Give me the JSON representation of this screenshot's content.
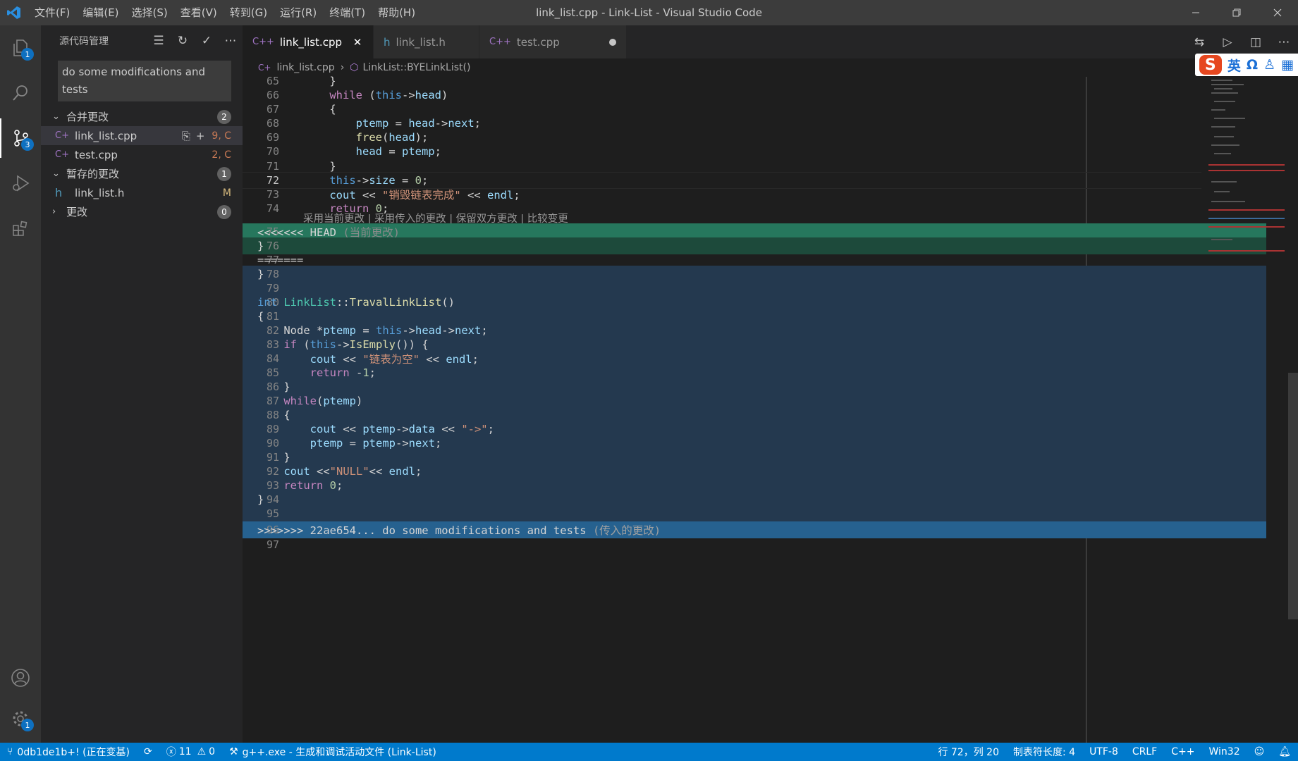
{
  "window": {
    "title": "link_list.cpp - Link-List - Visual Studio Code",
    "menu": [
      "文件(F)",
      "编辑(E)",
      "选择(S)",
      "查看(V)",
      "转到(G)",
      "运行(R)",
      "终端(T)",
      "帮助(H)"
    ]
  },
  "activity": {
    "explorer_badge": "1",
    "scm_badge": "3",
    "settings_badge": "1"
  },
  "sidebar": {
    "title": "源代码管理",
    "commit_message": "do some modifications and tests",
    "merge_section": {
      "label": "合并更改",
      "count": "2"
    },
    "merge_files": [
      {
        "name": "link_list.cpp",
        "status": "9, C"
      },
      {
        "name": "test.cpp",
        "status": "2, C"
      }
    ],
    "staged_section": {
      "label": "暂存的更改",
      "count": "1"
    },
    "staged_files": [
      {
        "name": "link_list.h",
        "status": "M"
      }
    ],
    "changes_section": {
      "label": "更改",
      "count": "0"
    }
  },
  "tabs": [
    {
      "label": "link_list.cpp",
      "icon": "C++"
    },
    {
      "label": "link_list.h",
      "icon": "h"
    },
    {
      "label": "test.cpp",
      "icon": "C++"
    }
  ],
  "breadcrumb": {
    "file": "link_list.cpp",
    "symbol": "LinkList::BYELinkList()"
  },
  "ime": {
    "lang": "英"
  },
  "editor": {
    "codelens": "采用当前更改 | 采用传入的更改 | 保留双方更改 | 比较变更",
    "line_numbers": [
      "65",
      "66",
      "67",
      "68",
      "69",
      "70",
      "71",
      "72",
      "73",
      "74",
      "75",
      "76",
      "77",
      "78",
      "79",
      "80",
      "81",
      "82",
      "83",
      "84",
      "85",
      "86",
      "87",
      "88",
      "89",
      "90",
      "91",
      "92",
      "93",
      "94",
      "95",
      "96",
      "97"
    ],
    "head_marker": "<<<<<<< HEAD",
    "head_label": "(当前更改)",
    "separator": "=======",
    "incoming_marker": ">>>>>>> 22ae654... do some modifications and tests",
    "incoming_label": "(传入的更改)",
    "str_destroy": "\"销毁链表完成\"",
    "str_empty": "\"链表为空\"",
    "str_arrow": "\"->\"",
    "str_null": "\"NULL\""
  },
  "status": {
    "branch": "0db1de1b+! (正在变基)",
    "errors": "11",
    "warnings": "0",
    "task": "g++.exe - 生成和调试活动文件 (Link-List)",
    "position": "行 72，列 20",
    "tab_size": "制表符长度: 4",
    "encoding": "UTF-8",
    "eol": "CRLF",
    "language": "C++",
    "platform": "Win32"
  },
  "colors": {
    "statusbar": "#007acc",
    "current_change_header": "#26775d",
    "current_change_body": "#1d4a3b",
    "incoming_change_header": "#26618f",
    "incoming_change_body": "#24394f"
  }
}
